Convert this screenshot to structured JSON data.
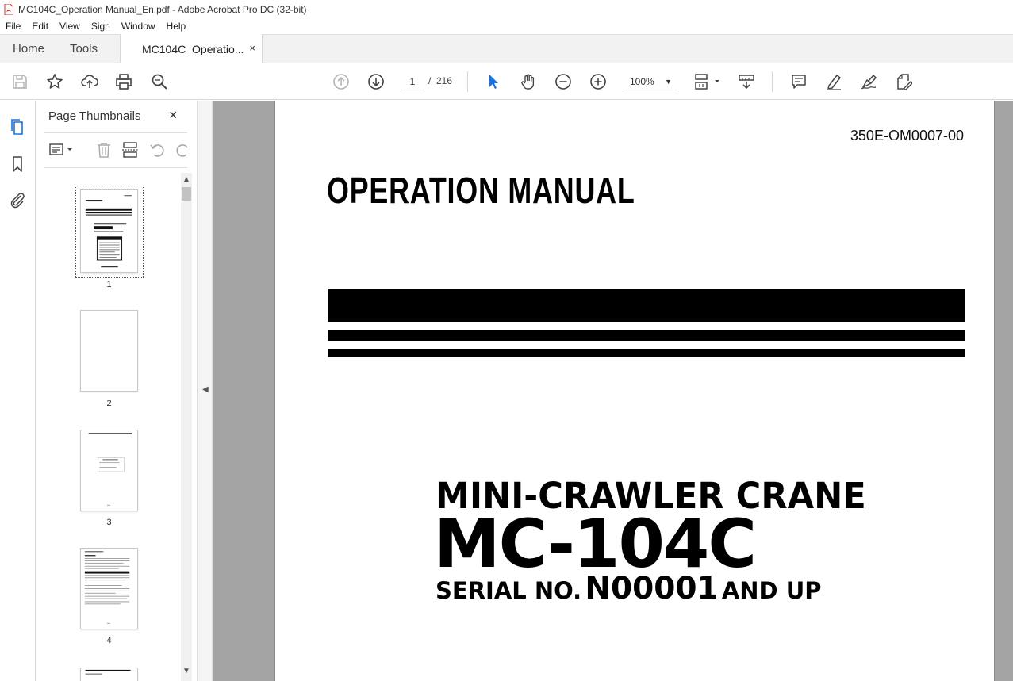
{
  "window": {
    "title": "MC104C_Operation Manual_En.pdf - Adobe Acrobat Pro DC (32-bit)"
  },
  "menu": {
    "items": [
      "File",
      "Edit",
      "View",
      "Sign",
      "Window",
      "Help"
    ]
  },
  "tabs": {
    "home": "Home",
    "tools": "Tools",
    "document": "MC104C_Operatio...",
    "close_glyph": "×"
  },
  "toolbar": {
    "current_page": "1",
    "page_separator": "/",
    "total_pages": "216",
    "zoom": "100%",
    "icons": [
      "save-icon",
      "star-icon",
      "upload-cloud-icon",
      "print-icon",
      "search-icon",
      "page-up-icon",
      "page-down-icon",
      "select-arrow-icon",
      "hand-icon",
      "zoom-out-icon",
      "zoom-in-icon",
      "fit-page-icon",
      "scroll-mode-icon",
      "comment-icon",
      "highlight-icon",
      "sign-icon",
      "edit-pdf-icon"
    ]
  },
  "left_rail": {
    "icons": [
      "page-thumbnails-icon",
      "bookmark-icon",
      "attachment-icon"
    ]
  },
  "thumbnail_panel": {
    "title": "Page Thumbnails",
    "close_glyph": "×",
    "thumbnails": [
      {
        "label": "1",
        "selected": true
      },
      {
        "label": "2",
        "selected": false
      },
      {
        "label": "3",
        "selected": false
      },
      {
        "label": "4",
        "selected": false
      }
    ]
  },
  "document_page": {
    "code": "350E-OM0007-00",
    "heading": "OPERATION MANUAL",
    "product_type": "MINI-CRAWLER CRANE",
    "model": "MC-104C",
    "serial_prefix": "SERIAL NO.",
    "serial_number": "N00001",
    "serial_suffix": "AND UP"
  },
  "colors": {
    "acrobat_red": "#d62a2a",
    "select_blue": "#1473e6",
    "doc_bg": "#a4a4a4"
  }
}
